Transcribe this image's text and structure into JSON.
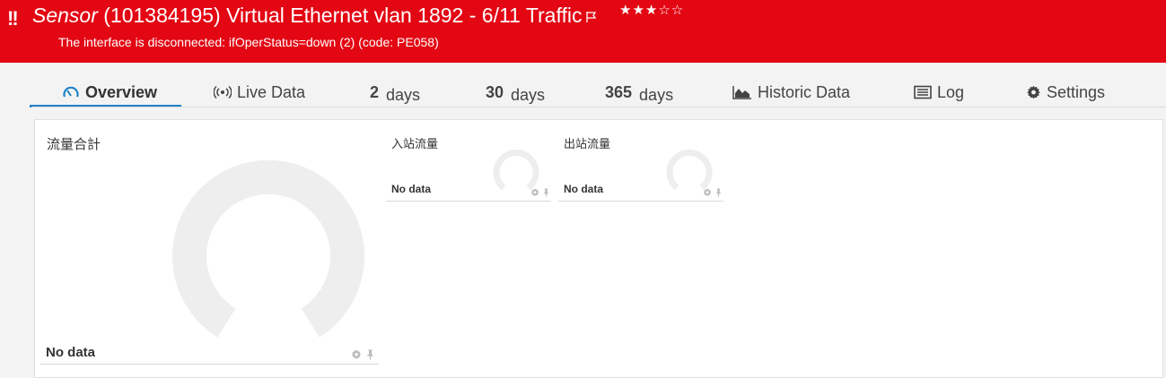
{
  "header": {
    "alert_symbol": "!!",
    "title_prefix": "Sensor",
    "title_rest": "(101384195) Virtual Ethernet vlan 1892 - 6/11 Traffic",
    "stars": "★★★☆☆",
    "rating": 3,
    "rating_max": 5,
    "message": "The interface is disconnected: ifOperStatus=down (2) (code: PE058)",
    "background_color": "#e30613"
  },
  "tabs": [
    {
      "label": "Overview",
      "icon": "gauge-icon",
      "active": true
    },
    {
      "label": "Live Data",
      "icon": "broadcast-icon"
    },
    {
      "num": "2",
      "unit": "days"
    },
    {
      "num": "30",
      "unit": "days"
    },
    {
      "num": "365",
      "unit": "days"
    },
    {
      "label": "Historic Data",
      "icon": "area-chart-icon"
    },
    {
      "label": "Log",
      "icon": "list-icon"
    },
    {
      "label": "Settings",
      "icon": "gear-icon"
    }
  ],
  "accent_color": "#1e82c8",
  "gauges": [
    {
      "title": "流量合計",
      "status": "No data"
    },
    {
      "title": "入站流量",
      "status": "No data"
    },
    {
      "title": "出站流量",
      "status": "No data"
    }
  ]
}
